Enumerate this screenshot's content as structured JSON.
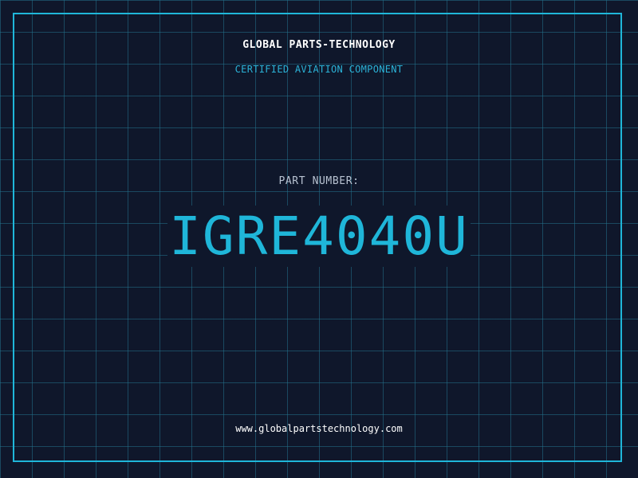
{
  "header": {
    "brand": "GLOBAL PARTS-TECHNOLOGY",
    "subtitle": "CERTIFIED AVIATION COMPONENT"
  },
  "main": {
    "part_label": "PART NUMBER:",
    "part_number": "IGRE4040U"
  },
  "footer": {
    "website": "www.globalpartstechnology.com"
  },
  "colors": {
    "background": "#0f172b",
    "accent": "#1fb6d9",
    "grid": "#22728c",
    "text": "#ffffff",
    "muted": "#b8c2d1"
  }
}
